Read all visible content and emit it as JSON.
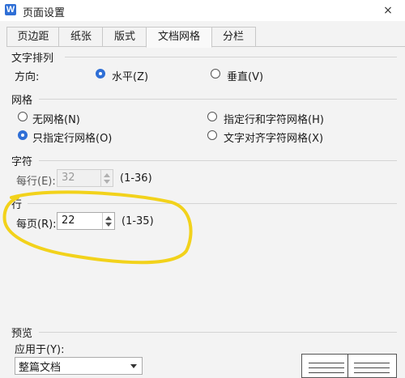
{
  "window": {
    "app_icon_letter": "W",
    "title": "页面设置",
    "close_glyph": "×"
  },
  "tabs": [
    {
      "label": "页边距",
      "active": false
    },
    {
      "label": "纸张",
      "active": false
    },
    {
      "label": "版式",
      "active": false
    },
    {
      "label": "文档网格",
      "active": true
    },
    {
      "label": "分栏",
      "active": false
    }
  ],
  "text_direction": {
    "section_title": "文字排列",
    "direction_label": "方向:",
    "options": [
      {
        "label": "水平(Z)",
        "checked": true
      },
      {
        "label": "垂直(V)",
        "checked": false
      }
    ]
  },
  "grid": {
    "section_title": "网格",
    "options": [
      {
        "label": "无网格(N)",
        "checked": false
      },
      {
        "label": "指定行和字符网格(H)",
        "checked": false
      },
      {
        "label": "只指定行网格(O)",
        "checked": true
      },
      {
        "label": "文字对齐字符网格(X)",
        "checked": false
      }
    ]
  },
  "chars": {
    "section_title": "字符",
    "per_line_label": "每行(E):",
    "per_line_value": "32",
    "range": "(1-36)",
    "disabled": true
  },
  "lines": {
    "section_title": "行",
    "per_page_label": "每页(R):",
    "per_page_value": "22",
    "range": "(1-35)"
  },
  "preview": {
    "section_title": "预览",
    "apply_to_label": "应用于(Y):",
    "apply_to_value": "整篇文档"
  },
  "colors": {
    "accent": "#2f6fd6",
    "highlight_circle": "#f2d21b"
  }
}
